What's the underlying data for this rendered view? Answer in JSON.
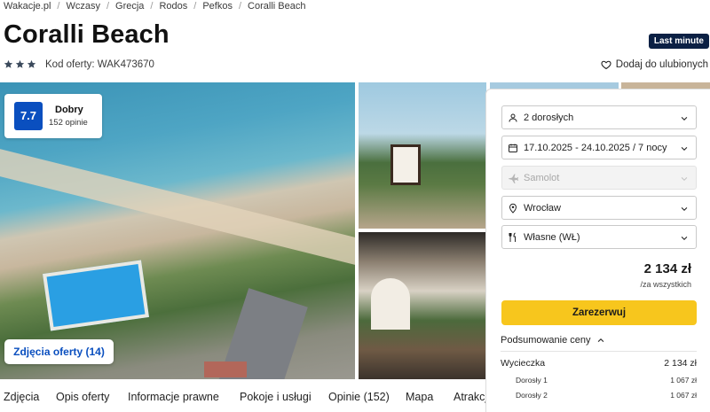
{
  "breadcrumb": [
    "Wakacje.pl",
    "Wczasy",
    "Grecja",
    "Rodos",
    "Pefkos",
    "Coralli Beach"
  ],
  "hotel": {
    "name": "Coralli Beach",
    "stars": 3,
    "offer_code": "Kod oferty: WAK473670",
    "badge": "Last minute",
    "favorite_label": "Dodaj do ulubionych"
  },
  "rating": {
    "score": "7.7",
    "label": "Dobry",
    "count": "152 opinie"
  },
  "gallery": {
    "photos_button": "Zdjęcia oferty (14)"
  },
  "tabs": [
    "Zdjęcia",
    "Opis oferty",
    "Informacje prawne",
    "Pokoje i usługi",
    "Opinie (152)",
    "Mapa",
    "Atrakcje"
  ],
  "booking": {
    "travelers": "2 dorosłych",
    "dates": "17.10.2025 - 24.10.2025 / 7 nocy",
    "transport": "Samolot",
    "departure": "Wrocław",
    "board": "Własne (WŁ)",
    "price": "2 134 zł",
    "price_note": "/za wszystkich",
    "reserve_label": "Zarezerwuj",
    "summary_label": "Podsumowanie ceny",
    "summary": [
      {
        "label": "Wycieczka",
        "value": "2 134 zł"
      },
      {
        "label": "Dorosły 1",
        "value": "1 067 zł"
      },
      {
        "label": "Dorosły 2",
        "value": "1 067 zł"
      }
    ]
  },
  "colors": {
    "brand_blue": "#0a4fbf",
    "accent_yellow": "#f7c61d",
    "badge_navy": "#0b2044"
  },
  "icons": [
    "star-icon",
    "heart-icon",
    "person-icon",
    "calendar-icon",
    "plane-icon",
    "location-pin-icon",
    "cutlery-icon",
    "chevron-down-icon",
    "chevron-up-icon"
  ]
}
